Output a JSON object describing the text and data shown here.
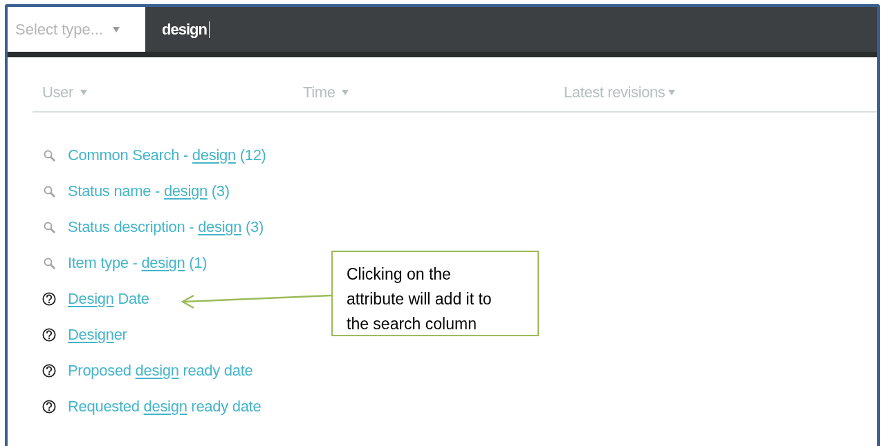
{
  "type_select": {
    "placeholder": "Select type..."
  },
  "search": {
    "value": "design"
  },
  "columns": [
    {
      "label": "User"
    },
    {
      "label": "Time"
    },
    {
      "label": "Latest revisions"
    }
  ],
  "results": [
    {
      "kind": "search",
      "before": "Common Search - ",
      "match": "design",
      "after": " (12)"
    },
    {
      "kind": "search",
      "before": "Status name - ",
      "match": "design",
      "after": " (3)"
    },
    {
      "kind": "search",
      "before": "Status description - ",
      "match": "design",
      "after": " (3)"
    },
    {
      "kind": "search",
      "before": "Item type - ",
      "match": "design",
      "after": " (1)"
    },
    {
      "kind": "attribute",
      "match": "Design",
      "after": " Date"
    },
    {
      "kind": "attribute",
      "match": "Design",
      "after": "er"
    },
    {
      "kind": "attribute",
      "before": "Proposed ",
      "match": "design",
      "after": " ready date"
    },
    {
      "kind": "attribute",
      "before": "Requested ",
      "match": "design",
      "after": " ready date"
    }
  ],
  "callout": {
    "text": "Clicking on the attribute will add it to the search column"
  }
}
